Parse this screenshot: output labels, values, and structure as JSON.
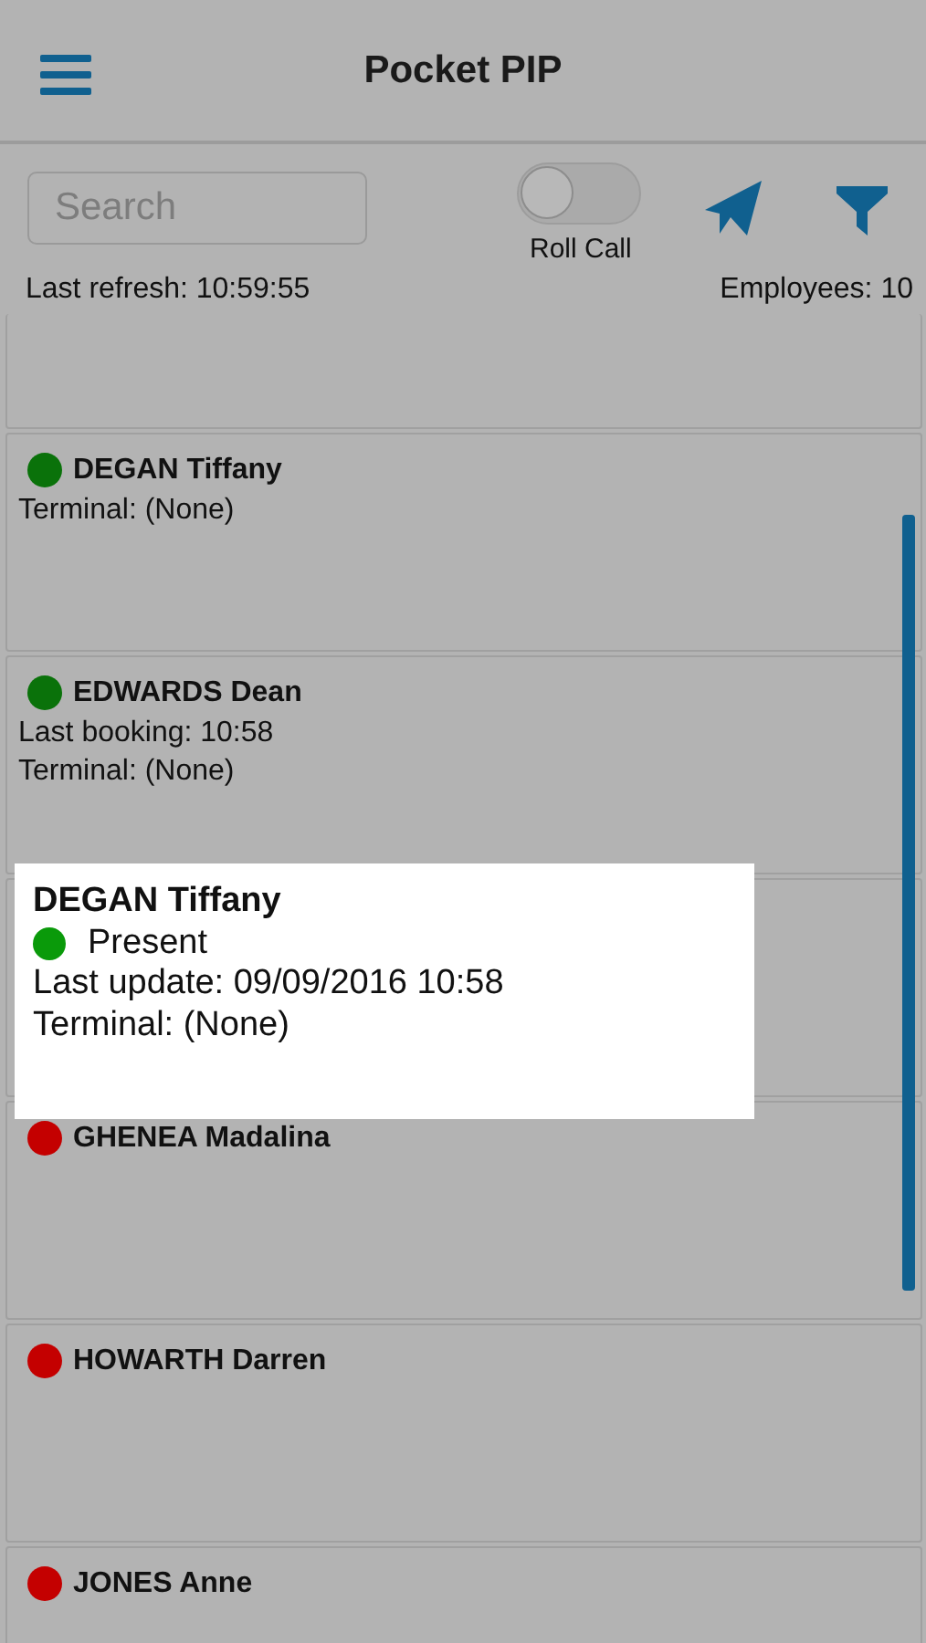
{
  "header": {
    "title": "Pocket PIP"
  },
  "toolbar": {
    "search": {
      "placeholder": "Search"
    },
    "roll_call": {
      "label": "Roll Call",
      "on": false
    },
    "last_refresh": "Last refresh: 10:59:55",
    "employees": "Employees: 10"
  },
  "cards": [
    {
      "kind": "empty"
    },
    {
      "kind": "employee",
      "name": "DEGAN Tiffany",
      "color": "#0a720a",
      "lines": [
        "Terminal: (None)"
      ]
    },
    {
      "kind": "employee",
      "name": "EDWARDS Dean",
      "color": "#0a720a",
      "lines": [
        "Last booking: 10:58",
        "Terminal: (None)"
      ]
    },
    {
      "kind": "empty"
    },
    {
      "kind": "employee",
      "name": "GHENEA Madalina",
      "color": "#c40000"
    },
    {
      "kind": "employee",
      "name": "HOWARTH Darren",
      "color": "#c40000"
    },
    {
      "kind": "employee",
      "name": "JONES Anne",
      "color": "#c40000"
    }
  ],
  "popup": {
    "name": "DEGAN Tiffany",
    "status": "Present",
    "color": "#0a9a0a",
    "last_update": "Last update: 09/09/2016 10:58",
    "terminal": "Terminal: (None)"
  }
}
